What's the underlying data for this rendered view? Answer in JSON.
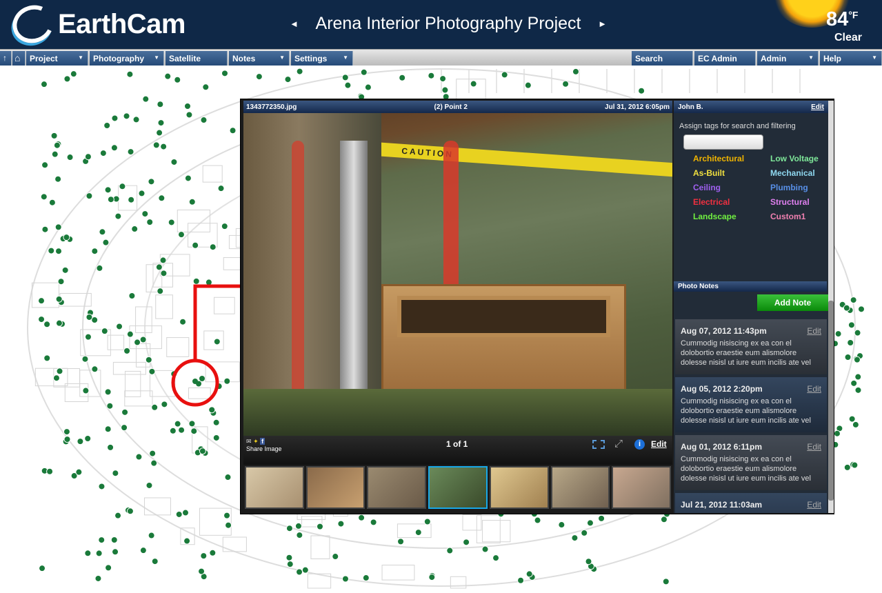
{
  "header": {
    "logo": "EarthCam",
    "project_title": "Arena Interior Photography Project",
    "prev_arrow": "◄",
    "next_arrow": "►",
    "temperature": "84",
    "temp_unit": "°F",
    "condition": "Clear"
  },
  "nav": {
    "left": [
      {
        "label": "Project",
        "dropdown": true
      },
      {
        "label": "Photography",
        "dropdown": true
      },
      {
        "label": "Satellite",
        "dropdown": false
      },
      {
        "label": "Notes",
        "dropdown": true
      },
      {
        "label": "Settings",
        "dropdown": true
      }
    ],
    "right": [
      {
        "label": "Search",
        "dropdown": false
      },
      {
        "label": "EC Admin",
        "dropdown": false
      },
      {
        "label": "Admin",
        "dropdown": true
      },
      {
        "label": "Help",
        "dropdown": true
      }
    ],
    "up_icon": "↑",
    "home_icon": "⌂",
    "dropdown_glyph": "▼"
  },
  "viewer": {
    "filename": "1343772350.jpg",
    "point": "(2) Point 2",
    "datetime": "Jul 31, 2012 6:05pm",
    "caution_text": "CAUTION",
    "share_label": "Share Image",
    "page": "1 of 1",
    "edit": "Edit",
    "thumbnail_count": 7,
    "selected_thumbnail": 4
  },
  "side": {
    "user": "John B.",
    "edit": "Edit",
    "tag_prompt": "Assign tags for search and filtering",
    "tag_input_value": "",
    "tags": [
      {
        "label": "Architectural",
        "color": "#f0b400"
      },
      {
        "label": "Low Voltage",
        "color": "#7fe89a"
      },
      {
        "label": "As-Built",
        "color": "#f0e040"
      },
      {
        "label": "Mechanical",
        "color": "#8fd8f0"
      },
      {
        "label": "Ceiling",
        "color": "#a060f0"
      },
      {
        "label": "Plumbing",
        "color": "#5890e8"
      },
      {
        "label": "Electrical",
        "color": "#f03040"
      },
      {
        "label": "Structural",
        "color": "#e080f0"
      },
      {
        "label": "Landscape",
        "color": "#70f040"
      },
      {
        "label": "Custom1",
        "color": "#f080b0"
      }
    ],
    "notes_title": "Photo Notes",
    "add_note": "Add Note",
    "notes": [
      {
        "date": "Aug 07, 2012 11:43pm",
        "text": "Cummodig nisiscing ex ea con el dolobortio eraestie eum alismolore dolesse nisisl ut iure eum incilis ate vel",
        "edit": "Edit"
      },
      {
        "date": "Aug 05, 2012 2:20pm",
        "text": "Cummodig nisiscing ex ea con el dolobortio eraestie eum alismolore dolesse nisisl ut iure eum incilis ate vel",
        "edit": "Edit"
      },
      {
        "date": "Aug 01, 2012 6:11pm",
        "text": "Cummodig nisiscing ex ea con el dolobortio eraestie eum alismolore dolesse nisisl ut iure eum incilis ate vel",
        "edit": "Edit"
      },
      {
        "date": "Jul 21, 2012 11:03am",
        "text": "",
        "edit": "Edit"
      }
    ]
  }
}
